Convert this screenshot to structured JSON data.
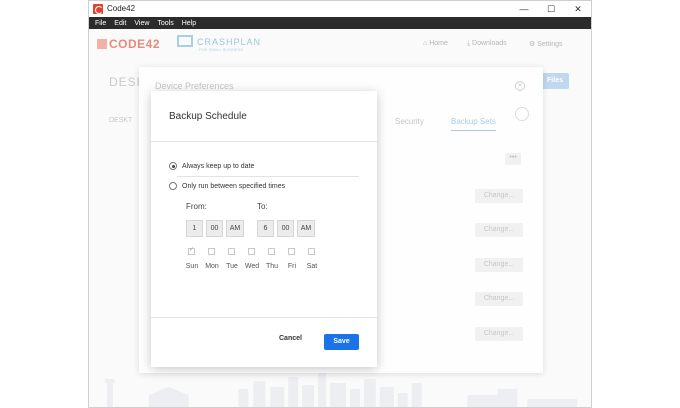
{
  "window": {
    "title": "Code42",
    "minimize": "—",
    "maximize": "☐",
    "close": "✕"
  },
  "menu": [
    "File",
    "Edit",
    "View",
    "Tools",
    "Help"
  ],
  "header": {
    "logo_code42": "CODE42",
    "logo_crashplan": "CRASHPLAN",
    "logo_crashplan_sub": "FOR SMALL BUSINESS",
    "nav_home": "Home",
    "nav_downloads": "Downloads",
    "nav_settings": "Settings"
  },
  "background": {
    "title": "DESK",
    "subtitle": "DESKT",
    "files_btn": "Files"
  },
  "prefs": {
    "title": "Device Preferences",
    "tab_security": "Security",
    "tab_backup_sets": "Backup Sets",
    "more": "•••",
    "change_label": "Change..."
  },
  "dialog": {
    "title": "Backup Schedule",
    "option_always": "Always keep up to date",
    "option_specified": "Only run between specified times",
    "from_label": "From:",
    "to_label": "To:",
    "from_hour": "1",
    "from_minute": "00",
    "from_ampm": "AM",
    "to_hour": "6",
    "to_minute": "00",
    "to_ampm": "AM",
    "days": [
      "Sun",
      "Mon",
      "Tue",
      "Wed",
      "Thu",
      "Fri",
      "Sat"
    ],
    "cancel": "Cancel",
    "save": "Save"
  },
  "colors": {
    "accent": "#1a73e8",
    "menubar": "#2b2b2b",
    "brand_red": "#e2422b"
  }
}
